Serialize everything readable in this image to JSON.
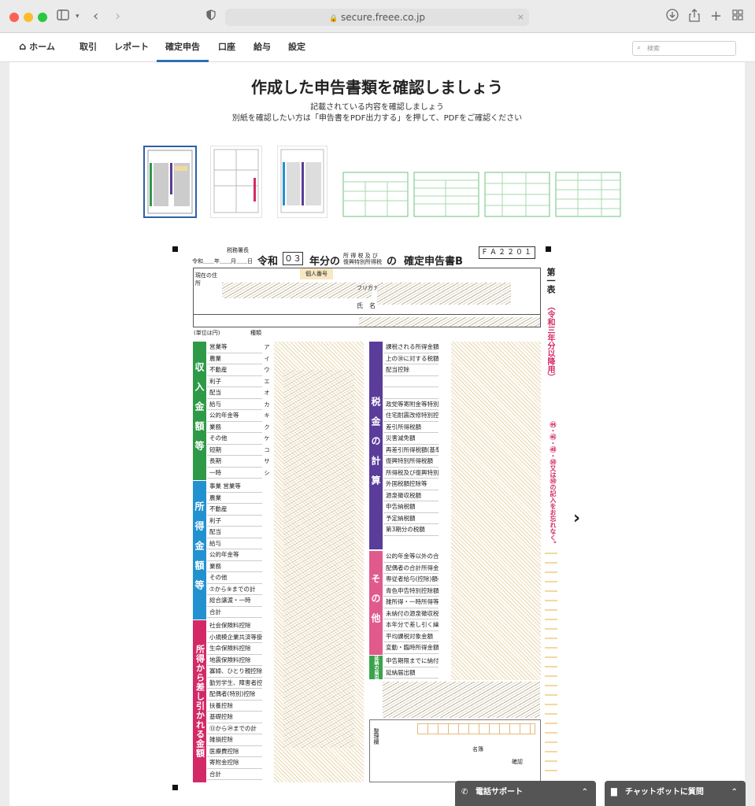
{
  "browser": {
    "url": "secure.freee.co.jp",
    "traffic_colors": [
      "#fe5f57",
      "#febc2e",
      "#28c840"
    ]
  },
  "nav": {
    "home": "ホーム",
    "items": [
      "取引",
      "レポート",
      "確定申告",
      "口座",
      "給与",
      "設定"
    ],
    "active": "確定申告",
    "search_placeholder": "検索",
    "accent": "#2f6fb6"
  },
  "page": {
    "title": "作成した申告書類を確認しましょう",
    "line1": "記載されている内容を確認しましょう",
    "line2": "別紙を確認したい方は「申告書をPDF出力する」を押して、PDFをご確認ください"
  },
  "form": {
    "office": "税務署長",
    "era": "令和",
    "year": "０３",
    "title_year_suffix": "年分の",
    "tax_small_1": "所 得 税 及 び",
    "tax_small_2": "復興特別所得税",
    "of": "の",
    "title": "確定申告書B",
    "code": "ＦＡ２２０１",
    "date_line": "令和＿＿年＿＿月＿＿日",
    "address_label": "現在の住所",
    "mynumber_label": "個人番号",
    "furigana_label": "フリガナ",
    "name_label": "氏　名",
    "unit_label": "(単位は円)",
    "kind_label": "種類",
    "side_label": "第一表",
    "side_year": "（令和三年分以降用）",
    "side_note": "㊹・㊻・㊾・㊿又は㊿の記入をお忘れなく。",
    "left_sections": [
      {
        "label": "収入金額等",
        "color": "#2e9a48"
      },
      {
        "label": "所得金額等",
        "color": "#2291d0"
      },
      {
        "label": "所得から差し引かれる金額",
        "color": "#d32a67"
      }
    ],
    "right_sections": [
      {
        "label": "税金の計算",
        "color": "#5a3c9a"
      },
      {
        "label": "その他",
        "color": "#e05b8c"
      },
      {
        "label": "延納の届出",
        "color": "#3aa34c"
      }
    ],
    "rows_income": [
      "営業等",
      "農業",
      "不動産",
      "利子",
      "配当",
      "給与",
      "公的年金等",
      "業務",
      "その他",
      "短期",
      "長期",
      "一時"
    ],
    "rows_income_nums": [
      "ア",
      "イ",
      "ウ",
      "エ",
      "オ",
      "カ",
      "キ",
      "ク",
      "ケ",
      "コ",
      "サ",
      "シ"
    ],
    "rows_shotoku": [
      "事業 営業等",
      "農業",
      "不動産",
      "利子",
      "配当",
      "給与",
      "公的年金等",
      "業務",
      "その他",
      "⑦から⑨までの計",
      "総合譲渡・一時",
      "合計"
    ],
    "rows_kojo": [
      "社会保険料控除",
      "小規模企業共済等掛金控除",
      "生命保険料控除",
      "地震保険料控除",
      "寡婦、ひとり親控除",
      "勤労学生、障害者控除",
      "配偶者(特別)控除",
      "扶養控除",
      "基礎控除",
      "⑬から㉔までの計",
      "雑損控除",
      "医療費控除",
      "寄附金控除",
      "合計"
    ],
    "rows_tax": [
      "課税される所得金額",
      "上の㉚に対する税額",
      "配当控除",
      "",
      "",
      "政党等寄附金等特別控除",
      "住宅耐震改修特別控除等",
      "差引所得税額",
      "災害減免額",
      "再差引所得税額(基準所得税額)",
      "復興特別所得税額",
      "所得税及び復興特別所得税の額",
      "外国税額控除等",
      "源泉徴収税額",
      "申告納税額",
      "予定納税額",
      "第3期分の税額"
    ],
    "rows_sonota": [
      "公的年金等以外の合計所得金額",
      "配偶者の合計所得金額",
      "専従者給与(控除)額の合計額",
      "青色申告特別控除額",
      "雑所得・一時所得等の源泉徴収税額の合計額",
      "未納付の源泉徴収税額",
      "本年分で差し引く繰越損失額",
      "平均課税対象金額",
      "変動・臨時所得金額"
    ],
    "rows_ennou": [
      "申告期限までに納付する金額",
      "延納届出額"
    ],
    "right_nums_start": 30,
    "misc_labels": [
      "整理欄",
      "名簿",
      "確認"
    ]
  },
  "support": {
    "phone_label": "電話サポート",
    "chat_label": "チャットボットに質問"
  }
}
